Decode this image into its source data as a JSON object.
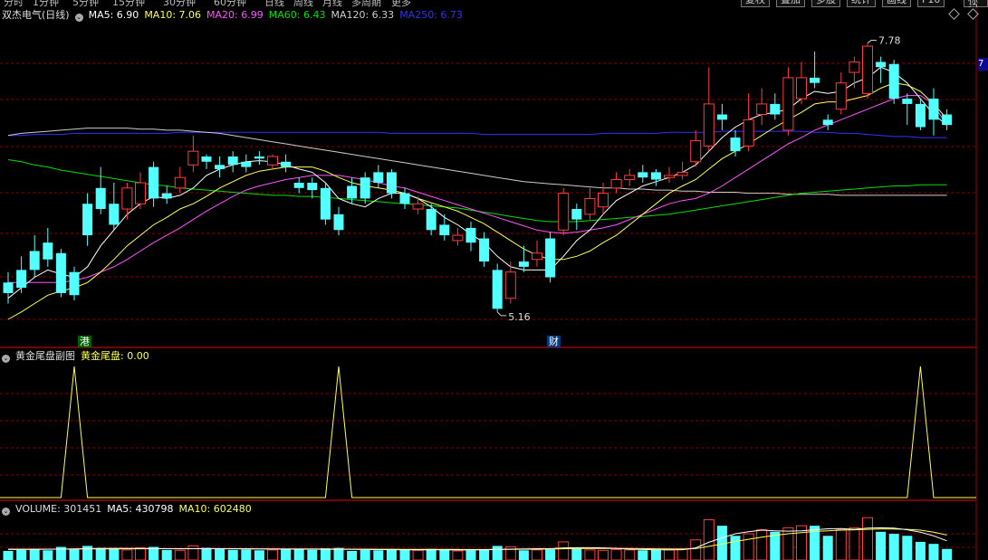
{
  "top_tabs": [
    "分时",
    "1分钟",
    "5分钟",
    "15分钟",
    "30分钟",
    "60分钟",
    "日线",
    "周线",
    "月线",
    "多周期",
    "更多"
  ],
  "top_buttons": [
    "复权",
    "叠加",
    "多股",
    "统计",
    "画线",
    "F10",
    "标记",
    "-"
  ],
  "main_header": {
    "title": "双杰电气(日线)",
    "ma5": "MA5: 6.90",
    "ma10": "MA10: 7.06",
    "ma20": "MA20: 6.99",
    "ma60": "MA60: 6.43",
    "ma120": "MA120: 6.33",
    "ma250": "MA250: 6.73"
  },
  "price_tag": "7",
  "annotations": {
    "high": "7.78",
    "low": "5.16",
    "port_badge": "港",
    "fin_badge": "财"
  },
  "sub_header": {
    "name": "黄金尾盘副图",
    "value": "黄金尾盘: 0.00"
  },
  "vol_header": {
    "volume": "VOLUME: 301451",
    "ma5": "MA5: 430798",
    "ma10": "MA10: 602480"
  },
  "colors": {
    "up": "#ff3c3c",
    "down": "#54ffff",
    "ma5": "#ffffff",
    "ma10": "#ffff54",
    "ma20": "#ff54ff",
    "ma60": "#00e000",
    "ma120": "#cccccc",
    "ma250": "#3030ff",
    "grid": "#800000",
    "sub": "#ffff54"
  },
  "chart_data": {
    "type": "candlestick",
    "price_range": [
      4.9,
      8.0
    ],
    "candles": [
      [
        5.5,
        5.4,
        5.6,
        5.3
      ],
      [
        5.62,
        5.45,
        5.75,
        5.4
      ],
      [
        5.8,
        5.62,
        5.95,
        5.55
      ],
      [
        5.88,
        5.72,
        6.02,
        5.65
      ],
      [
        5.78,
        5.4,
        5.82,
        5.36
      ],
      [
        5.6,
        5.38,
        5.65,
        5.33
      ],
      [
        6.25,
        5.95,
        6.35,
        5.85
      ],
      [
        6.4,
        6.2,
        6.6,
        6.15
      ],
      [
        6.25,
        6.05,
        6.45,
        6.0
      ],
      [
        6.2,
        6.4,
        6.45,
        6.1
      ],
      [
        6.25,
        6.45,
        6.55,
        6.2
      ],
      [
        6.6,
        6.3,
        6.65,
        6.22
      ],
      [
        6.35,
        6.3,
        6.42,
        6.25
      ],
      [
        6.4,
        6.5,
        6.6,
        6.35
      ],
      [
        6.62,
        6.75,
        6.9,
        6.55
      ],
      [
        6.7,
        6.65,
        6.72,
        6.58
      ],
      [
        6.62,
        6.58,
        6.7,
        6.5
      ],
      [
        6.7,
        6.62,
        6.75,
        6.55
      ],
      [
        6.65,
        6.6,
        6.72,
        6.55
      ],
      [
        6.7,
        6.68,
        6.75,
        6.62
      ],
      [
        6.62,
        6.7,
        6.72,
        6.58
      ],
      [
        6.65,
        6.6,
        6.72,
        6.55
      ],
      [
        6.45,
        6.4,
        6.5,
        6.35
      ],
      [
        6.45,
        6.38,
        6.5,
        6.3
      ],
      [
        6.4,
        6.1,
        6.45,
        6.05
      ],
      [
        6.15,
        6.0,
        6.22,
        5.95
      ],
      [
        6.42,
        6.3,
        6.5,
        6.25
      ],
      [
        6.5,
        6.3,
        6.55,
        6.25
      ],
      [
        6.55,
        6.45,
        6.62,
        6.4
      ],
      [
        6.55,
        6.35,
        6.58,
        6.3
      ],
      [
        6.35,
        6.25,
        6.4,
        6.2
      ],
      [
        6.2,
        6.25,
        6.32,
        6.15
      ],
      [
        6.2,
        6.0,
        6.25,
        5.95
      ],
      [
        6.05,
        5.95,
        6.15,
        5.9
      ],
      [
        5.9,
        5.95,
        6.02,
        5.85
      ],
      [
        6.02,
        5.88,
        6.08,
        5.8
      ],
      [
        5.92,
        5.7,
        5.98,
        5.65
      ],
      [
        5.62,
        5.25,
        5.68,
        5.22
      ],
      [
        5.35,
        5.6,
        5.7,
        5.3
      ],
      [
        5.7,
        5.65,
        5.85,
        5.6
      ],
      [
        5.72,
        5.78,
        5.9,
        5.65
      ],
      [
        5.92,
        5.55,
        5.98,
        5.5
      ],
      [
        6.0,
        6.35,
        6.4,
        5.95
      ],
      [
        6.2,
        6.1,
        6.25,
        6.0
      ],
      [
        6.15,
        6.3,
        6.4,
        6.1
      ],
      [
        6.22,
        6.35,
        6.45,
        6.15
      ],
      [
        6.4,
        6.48,
        6.55,
        6.35
      ],
      [
        6.48,
        6.52,
        6.58,
        6.42
      ],
      [
        6.55,
        6.5,
        6.62,
        6.45
      ],
      [
        6.55,
        6.48,
        6.58,
        6.42
      ],
      [
        6.5,
        6.52,
        6.6,
        6.45
      ],
      [
        6.52,
        6.55,
        6.65,
        6.48
      ],
      [
        6.65,
        6.85,
        6.95,
        6.6
      ],
      [
        6.8,
        7.2,
        7.55,
        6.75
      ],
      [
        7.1,
        7.05,
        7.2,
        6.95
      ],
      [
        6.88,
        6.75,
        6.95,
        6.7
      ],
      [
        6.8,
        7.05,
        7.3,
        6.75
      ],
      [
        7.1,
        7.2,
        7.35,
        7.0
      ],
      [
        7.2,
        7.1,
        7.3,
        7.05
      ],
      [
        6.95,
        7.45,
        7.55,
        6.9
      ],
      [
        7.25,
        7.45,
        7.6,
        7.2
      ],
      [
        7.45,
        7.4,
        7.7,
        7.35
      ],
      [
        7.05,
        7.0,
        7.1,
        6.95
      ],
      [
        7.15,
        7.4,
        7.5,
        7.1
      ],
      [
        7.5,
        7.6,
        7.65,
        7.35
      ],
      [
        7.3,
        7.75,
        7.78,
        7.25
      ],
      [
        7.6,
        7.55,
        7.65,
        7.4
      ],
      [
        7.58,
        7.25,
        7.62,
        7.2
      ],
      [
        7.25,
        7.2,
        7.3,
        7.0
      ],
      [
        7.2,
        6.98,
        7.25,
        6.95
      ],
      [
        7.25,
        7.05,
        7.35,
        6.9
      ],
      [
        7.1,
        7.0,
        7.15,
        6.95
      ]
    ],
    "ma5": [
      5.35,
      5.45,
      5.55,
      5.62,
      5.58,
      5.55,
      5.65,
      5.85,
      6.0,
      6.15,
      6.25,
      6.32,
      6.3,
      6.33,
      6.4,
      6.52,
      6.58,
      6.62,
      6.65,
      6.66,
      6.65,
      6.62,
      6.58,
      6.55,
      6.45,
      6.3,
      6.25,
      6.22,
      6.3,
      6.35,
      6.35,
      6.3,
      6.22,
      6.12,
      6.05,
      5.96,
      5.88,
      5.75,
      5.65,
      5.62,
      5.62,
      5.62,
      5.75,
      5.9,
      6.0,
      6.15,
      6.28,
      6.35,
      6.42,
      6.46,
      6.5,
      6.55,
      6.62,
      6.75,
      6.88,
      6.98,
      7.05,
      7.1,
      7.12,
      7.15,
      7.25,
      7.32,
      7.3,
      7.32,
      7.4,
      7.45,
      7.55,
      7.5,
      7.4,
      7.25,
      7.1,
      7.0
    ],
    "ma10": [
      5.15,
      5.22,
      5.3,
      5.38,
      5.42,
      5.45,
      5.5,
      5.6,
      5.72,
      5.85,
      5.95,
      6.05,
      6.12,
      6.2,
      6.25,
      6.32,
      6.4,
      6.46,
      6.52,
      6.56,
      6.58,
      6.6,
      6.6,
      6.6,
      6.56,
      6.5,
      6.45,
      6.42,
      6.4,
      6.38,
      6.35,
      6.3,
      6.26,
      6.22,
      6.18,
      6.12,
      6.06,
      5.98,
      5.9,
      5.82,
      5.76,
      5.72,
      5.72,
      5.75,
      5.8,
      5.88,
      5.95,
      6.05,
      6.15,
      6.25,
      6.35,
      6.42,
      6.48,
      6.58,
      6.68,
      6.75,
      6.82,
      6.9,
      6.98,
      7.05,
      7.12,
      7.2,
      7.22,
      7.22,
      7.25,
      7.28,
      7.35,
      7.4,
      7.38,
      7.32,
      7.2,
      7.06
    ],
    "ma20": [
      5.5,
      5.5,
      5.5,
      5.5,
      5.5,
      5.52,
      5.55,
      5.6,
      5.65,
      5.72,
      5.8,
      5.88,
      5.95,
      6.02,
      6.1,
      6.18,
      6.25,
      6.32,
      6.38,
      6.42,
      6.45,
      6.48,
      6.5,
      6.52,
      6.52,
      6.52,
      6.5,
      6.48,
      6.45,
      6.42,
      6.4,
      6.36,
      6.32,
      6.28,
      6.24,
      6.2,
      6.16,
      6.12,
      6.08,
      6.04,
      6.0,
      5.98,
      5.97,
      5.98,
      6.0,
      6.02,
      6.05,
      6.1,
      6.15,
      6.2,
      6.25,
      6.28,
      6.3,
      6.35,
      6.42,
      6.5,
      6.58,
      6.66,
      6.74,
      6.82,
      6.88,
      6.95,
      7.0,
      7.05,
      7.1,
      7.15,
      7.2,
      7.25,
      7.28,
      7.28,
      7.2,
      6.99
    ],
    "ma60": [
      6.67,
      6.65,
      6.62,
      6.6,
      6.57,
      6.55,
      6.53,
      6.51,
      6.49,
      6.47,
      6.45,
      6.43,
      6.42,
      6.4,
      6.39,
      6.38,
      6.37,
      6.36,
      6.35,
      6.34,
      6.33,
      6.33,
      6.32,
      6.32,
      6.31,
      6.3,
      6.29,
      6.28,
      6.27,
      6.26,
      6.25,
      6.24,
      6.23,
      6.22,
      6.21,
      6.19,
      6.17,
      6.15,
      6.13,
      6.11,
      6.09,
      6.08,
      6.08,
      6.08,
      6.09,
      6.1,
      6.11,
      6.12,
      6.13,
      6.14,
      6.15,
      6.17,
      6.19,
      6.21,
      6.23,
      6.25,
      6.27,
      6.29,
      6.31,
      6.33,
      6.35,
      6.36,
      6.37,
      6.38,
      6.39,
      6.4,
      6.41,
      6.42,
      6.42,
      6.43,
      6.43,
      6.43
    ],
    "ma120": [
      6.9,
      6.92,
      6.93,
      6.94,
      6.95,
      6.96,
      6.97,
      6.97,
      6.97,
      6.97,
      6.96,
      6.96,
      6.95,
      6.95,
      6.94,
      6.93,
      6.92,
      6.9,
      6.88,
      6.86,
      6.84,
      6.82,
      6.8,
      6.78,
      6.76,
      6.74,
      6.72,
      6.7,
      6.68,
      6.66,
      6.64,
      6.62,
      6.6,
      6.58,
      6.56,
      6.54,
      6.52,
      6.5,
      6.48,
      6.46,
      6.45,
      6.44,
      6.43,
      6.42,
      6.41,
      6.4,
      6.4,
      6.39,
      6.39,
      6.38,
      6.38,
      6.37,
      6.37,
      6.36,
      6.36,
      6.36,
      6.35,
      6.35,
      6.35,
      6.34,
      6.34,
      6.34,
      6.34,
      6.33,
      6.33,
      6.33,
      6.33,
      6.33,
      6.33,
      6.33,
      6.33,
      6.33
    ],
    "ma250": [
      6.9,
      6.9,
      6.91,
      6.91,
      6.91,
      6.92,
      6.92,
      6.92,
      6.92,
      6.92,
      6.92,
      6.92,
      6.92,
      6.93,
      6.93,
      6.93,
      6.93,
      6.93,
      6.93,
      6.93,
      6.93,
      6.93,
      6.93,
      6.93,
      6.93,
      6.93,
      6.93,
      6.93,
      6.93,
      6.92,
      6.92,
      6.92,
      6.92,
      6.92,
      6.92,
      6.92,
      6.91,
      6.91,
      6.91,
      6.91,
      6.91,
      6.91,
      6.91,
      6.91,
      6.91,
      6.92,
      6.92,
      6.92,
      6.92,
      6.92,
      6.93,
      6.93,
      6.93,
      6.93,
      6.94,
      6.94,
      6.94,
      6.94,
      6.94,
      6.94,
      6.94,
      6.93,
      6.93,
      6.92,
      6.92,
      6.91,
      6.9,
      6.89,
      6.89,
      6.88,
      6.88,
      6.88
    ],
    "sub_signal_peaks": [
      5,
      25,
      69
    ],
    "vol_range": [
      0,
      2200000
    ],
    "volume": [
      450000,
      500000,
      550000,
      480000,
      650000,
      520000,
      700000,
      600000,
      550000,
      500000,
      600000,
      650000,
      500000,
      480000,
      700000,
      600000,
      550000,
      500000,
      520000,
      480000,
      500000,
      520000,
      550000,
      500000,
      580000,
      600000,
      450000,
      500000,
      480000,
      520000,
      500000,
      480000,
      550000,
      500000,
      450000,
      480000,
      520000,
      700000,
      650000,
      480000,
      500000,
      520000,
      900000,
      550000,
      500000,
      480000,
      520000,
      500000,
      480000,
      520000,
      500000,
      550000,
      1000000,
      2000000,
      1700000,
      1200000,
      1300000,
      1500000,
      1400000,
      1600000,
      1700000,
      1700000,
      1200000,
      1500000,
      1600000,
      2100000,
      1400000,
      1300000,
      1200000,
      900000,
      800000,
      550000
    ],
    "vol_ma5": [
      520000,
      520000,
      530000,
      535000,
      540000,
      550000,
      560000,
      570000,
      580000,
      580000,
      575000,
      570000,
      560000,
      555000,
      560000,
      565000,
      565000,
      560000,
      555000,
      550000,
      545000,
      540000,
      540000,
      535000,
      535000,
      530000,
      525000,
      520000,
      515000,
      510000,
      505000,
      505000,
      505000,
      505000,
      500000,
      500000,
      505000,
      520000,
      540000,
      550000,
      560000,
      560000,
      600000,
      610000,
      610000,
      600000,
      580000,
      540000,
      520000,
      505000,
      505000,
      510000,
      600000,
      880000,
      1100000,
      1300000,
      1400000,
      1480000,
      1450000,
      1430000,
      1450000,
      1500000,
      1550000,
      1560000,
      1520000,
      1580000,
      1600000,
      1580000,
      1500000,
      1380000,
      1200000,
      950000
    ],
    "vol_ma10": [
      540000,
      540000,
      540000,
      540000,
      540000,
      545000,
      548000,
      550000,
      553000,
      556000,
      558000,
      560000,
      560000,
      560000,
      560000,
      560000,
      560000,
      558000,
      556000,
      554000,
      552000,
      550000,
      548000,
      546000,
      544000,
      542000,
      540000,
      538000,
      536000,
      534000,
      532000,
      530000,
      528000,
      526000,
      524000,
      522000,
      522000,
      525000,
      530000,
      535000,
      540000,
      545000,
      555000,
      565000,
      570000,
      575000,
      575000,
      570000,
      565000,
      555000,
      550000,
      545000,
      565000,
      680000,
      800000,
      920000,
      1030000,
      1130000,
      1220000,
      1300000,
      1360000,
      1420000,
      1450000,
      1480000,
      1500000,
      1520000,
      1540000,
      1540000,
      1520000,
      1480000,
      1380000,
      1240000
    ]
  }
}
